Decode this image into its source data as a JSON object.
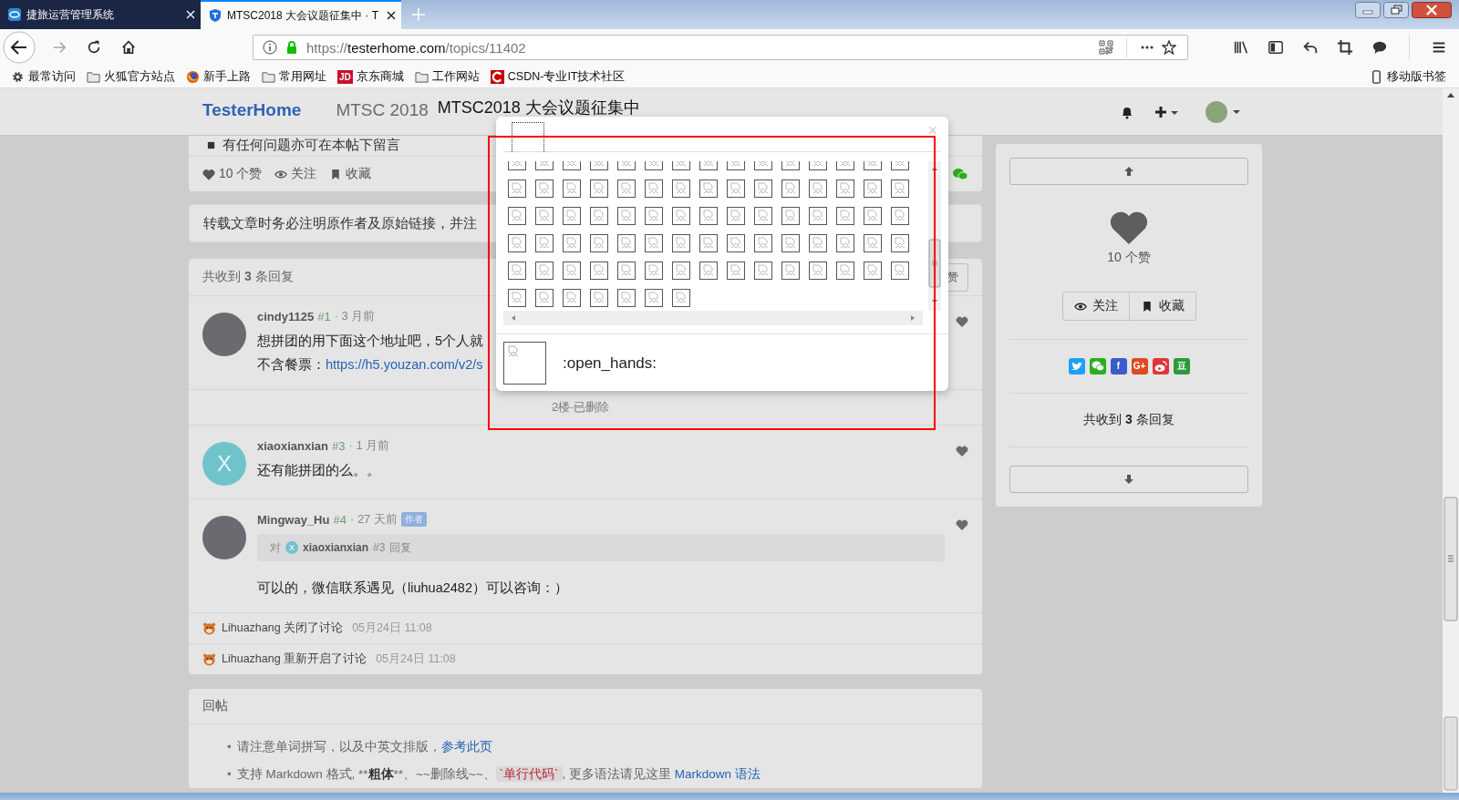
{
  "browser": {
    "tabs": [
      {
        "title": "捷旅运营管理系统",
        "selected": false
      },
      {
        "title": "MTSC2018 大会议题征集中 · T",
        "selected": true
      }
    ],
    "url": {
      "scheme": "https://",
      "host": "testerhome.com",
      "path": "/topics/11402"
    },
    "bookmarks": [
      {
        "label": "最常访问",
        "kind": "gear"
      },
      {
        "label": "火狐官方站点",
        "kind": "folder"
      },
      {
        "label": "新手上路",
        "kind": "firefox"
      },
      {
        "label": "常用网址",
        "kind": "folder"
      },
      {
        "label": "京东商城",
        "kind": "jd",
        "glyph": "JD"
      },
      {
        "label": "工作网站",
        "kind": "folder"
      },
      {
        "label": "CSDN-专业IT技术社区",
        "kind": "csdn"
      }
    ],
    "mobile_bookmarks": "移动版书签"
  },
  "site": {
    "brand": "TesterHome",
    "node": "MTSC 2018",
    "title": "MTSC2018 大会议题征集中"
  },
  "topic": {
    "marker": "■",
    "last_line": "有任何问题亦可在本帖下留言",
    "likes": "10 个赞",
    "follow": "关注",
    "favorite": "收藏"
  },
  "notice": "转载文章时务必注明原作者及原始链接，并注",
  "replies": {
    "header": "共收到 **3** 条回复",
    "header_button": "赞",
    "items": [
      {
        "kind": "reply",
        "user": "cindy1125",
        "floor": "#1",
        "time": "· 3 月前",
        "body": [
          {
            "text": "想拼团的用下面这个地址吧，5个人就"
          },
          {
            "text": "不含餐票：",
            "link": "https://h5.youzan.com/v2/s"
          }
        ]
      },
      {
        "kind": "deleted",
        "text": "2楼 已删除"
      },
      {
        "kind": "reply",
        "user": "xiaoxianxian",
        "floor": "#3",
        "time": "· 1 月前",
        "avatar_letter": "X",
        "body": [
          {
            "text": "还有能拼团的么。。"
          }
        ]
      },
      {
        "kind": "reply",
        "user": "Mingway_Hu",
        "floor": "#4",
        "time": "· 27 天前",
        "badge": "作者",
        "quote": {
          "prefix": "对",
          "avatar_letter": "X",
          "user": "xiaoxianxian",
          "floor": "#3",
          "suffix": "回复"
        },
        "body": [
          {
            "text": "可以的，微信联系遇见（liuhua2482）可以咨询：）"
          }
        ]
      },
      {
        "kind": "event",
        "user": "Lihuazhang",
        "action": "关闭了讨论",
        "time": "05月24日 11:08"
      },
      {
        "kind": "event",
        "user": "Lihuazhang",
        "action": "重新开启了讨论",
        "time": "05月24日 11:08"
      }
    ]
  },
  "reply_form": {
    "title": "回帖",
    "tips": [
      {
        "marker": "•",
        "parts": [
          {
            "kind": "plain",
            "text": "请注意单词拼写，以及中英文排版，"
          },
          {
            "kind": "link",
            "text": "参考此页"
          }
        ]
      },
      {
        "marker": "•",
        "parts": [
          {
            "kind": "plain",
            "text": "支持 Markdown 格式, **"
          },
          {
            "kind": "bold",
            "text": "粗体"
          },
          {
            "kind": "plain",
            "text": "**、~~删除线~~、"
          },
          {
            "kind": "code",
            "text": "`单行代码`"
          },
          {
            "kind": "plain",
            "text": ", 更多语法请见这里 "
          },
          {
            "kind": "link",
            "text": "Markdown 语法"
          }
        ]
      }
    ]
  },
  "sidebar": {
    "likes": "10 个赞",
    "follow": "关注",
    "favorite": "收藏",
    "reply_count": "共收到 **3** 条回复",
    "share": [
      {
        "kind": "twitter",
        "color": "#1da1f2"
      },
      {
        "kind": "wechat",
        "color": "#2dad1f"
      },
      {
        "kind": "facebook",
        "glyph": "f",
        "color": "#3b5ccc"
      },
      {
        "kind": "google",
        "glyph": "G+",
        "color": "#dd4b20"
      },
      {
        "kind": "weibo",
        "color": "#e0353a"
      },
      {
        "kind": "douban",
        "glyph": "豆",
        "color": "#2b9b3a"
      }
    ]
  },
  "emoji_dialog": {
    "close": "×",
    "preview": ":open_hands:"
  }
}
